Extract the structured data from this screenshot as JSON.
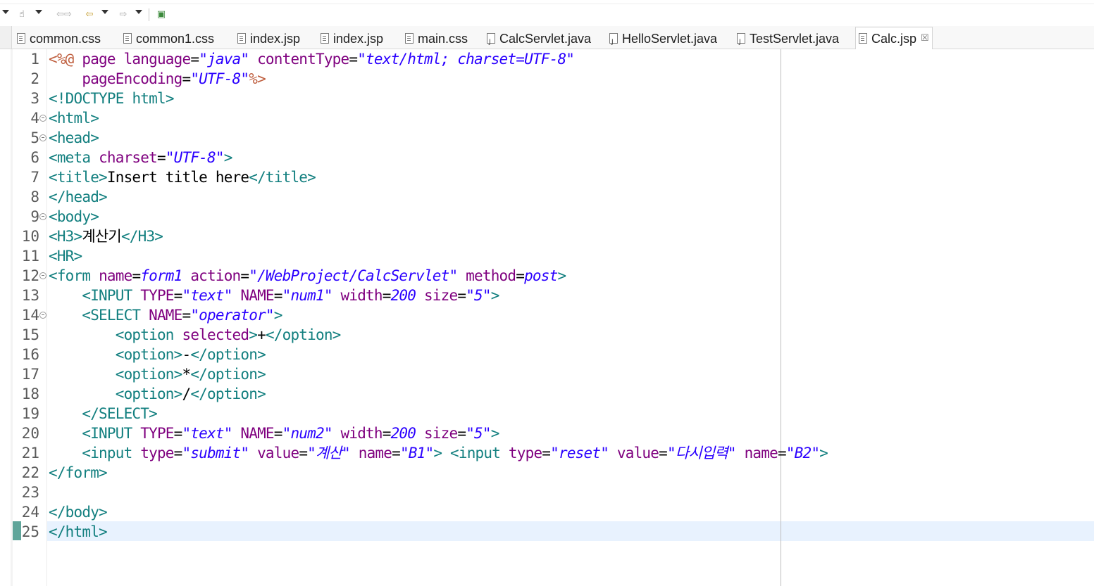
{
  "toolbar": {
    "items": [
      "▾",
      "☝",
      "▾",
      "⇦⇨",
      "⇦",
      "▾",
      "⇨",
      "▾",
      "▣"
    ]
  },
  "tabs": [
    {
      "label": "common.css",
      "type": "css"
    },
    {
      "label": "common1.css",
      "type": "css"
    },
    {
      "label": "index.jsp",
      "type": "jsp"
    },
    {
      "label": "index.jsp",
      "type": "jsp"
    },
    {
      "label": "main.css",
      "type": "css"
    },
    {
      "label": "CalcServlet.java",
      "type": "java"
    },
    {
      "label": "HelloServlet.java",
      "type": "java"
    },
    {
      "label": "TestServlet.java",
      "type": "java"
    },
    {
      "label": "Calc.jsp",
      "type": "jsp",
      "active": true,
      "close": "☒"
    }
  ],
  "editor": {
    "current_line": 25,
    "lines": [
      {
        "n": "1",
        "fold": false,
        "tokens": [
          [
            "jd",
            "<%@"
          ],
          [
            "tx",
            " "
          ],
          [
            "at",
            "page"
          ],
          [
            "tx",
            " "
          ],
          [
            "at",
            "language"
          ],
          [
            "tx",
            "="
          ],
          [
            "av",
            "\"java\""
          ],
          [
            "tx",
            " "
          ],
          [
            "at",
            "contentType"
          ],
          [
            "tx",
            "="
          ],
          [
            "av",
            "\"text/html; charset=UTF-8\""
          ]
        ]
      },
      {
        "n": "2",
        "fold": false,
        "tokens": [
          [
            "tx",
            "    "
          ],
          [
            "at",
            "pageEncoding"
          ],
          [
            "tx",
            "="
          ],
          [
            "av",
            "\"UTF-8\""
          ],
          [
            "jd",
            "%>"
          ]
        ]
      },
      {
        "n": "3",
        "fold": false,
        "tokens": [
          [
            "dt",
            "<!DOCTYPE"
          ],
          [
            "tx",
            " "
          ],
          [
            "dt",
            "html"
          ],
          [
            "dt",
            ">"
          ]
        ]
      },
      {
        "n": "4",
        "fold": true,
        "tokens": [
          [
            "tg",
            "<html>"
          ]
        ]
      },
      {
        "n": "5",
        "fold": true,
        "tokens": [
          [
            "tg",
            "<head>"
          ]
        ]
      },
      {
        "n": "6",
        "fold": false,
        "tokens": [
          [
            "tg",
            "<meta"
          ],
          [
            "tx",
            " "
          ],
          [
            "at",
            "charset"
          ],
          [
            "tx",
            "="
          ],
          [
            "av",
            "\"UTF-8\""
          ],
          [
            "tg",
            ">"
          ]
        ]
      },
      {
        "n": "7",
        "fold": false,
        "tokens": [
          [
            "tg",
            "<title>"
          ],
          [
            "tx",
            "Insert title here"
          ],
          [
            "tg",
            "</title>"
          ]
        ]
      },
      {
        "n": "8",
        "fold": false,
        "tokens": [
          [
            "tg",
            "</head>"
          ]
        ]
      },
      {
        "n": "9",
        "fold": true,
        "tokens": [
          [
            "tg",
            "<body>"
          ]
        ]
      },
      {
        "n": "10",
        "fold": false,
        "tokens": [
          [
            "tg",
            "<H3>"
          ],
          [
            "tx",
            "계산기"
          ],
          [
            "tg",
            "</H3>"
          ]
        ]
      },
      {
        "n": "11",
        "fold": false,
        "tokens": [
          [
            "tg",
            "<HR>"
          ]
        ]
      },
      {
        "n": "12",
        "fold": true,
        "tokens": [
          [
            "tg",
            "<form"
          ],
          [
            "tx",
            " "
          ],
          [
            "at",
            "name"
          ],
          [
            "tx",
            "="
          ],
          [
            "av",
            "form1"
          ],
          [
            "tx",
            " "
          ],
          [
            "at",
            "action"
          ],
          [
            "tx",
            "="
          ],
          [
            "av",
            "\"/WebProject/CalcServlet\""
          ],
          [
            "tx",
            " "
          ],
          [
            "at",
            "method"
          ],
          [
            "tx",
            "="
          ],
          [
            "av",
            "post"
          ],
          [
            "tg",
            ">"
          ]
        ]
      },
      {
        "n": "13",
        "fold": false,
        "tokens": [
          [
            "tx",
            "    "
          ],
          [
            "tg",
            "<INPUT"
          ],
          [
            "tx",
            " "
          ],
          [
            "at",
            "TYPE"
          ],
          [
            "tx",
            "="
          ],
          [
            "av",
            "\"text\""
          ],
          [
            "tx",
            " "
          ],
          [
            "at",
            "NAME"
          ],
          [
            "tx",
            "="
          ],
          [
            "av",
            "\"num1\""
          ],
          [
            "tx",
            " "
          ],
          [
            "at",
            "width"
          ],
          [
            "tx",
            "="
          ],
          [
            "av",
            "200"
          ],
          [
            "tx",
            " "
          ],
          [
            "at",
            "size"
          ],
          [
            "tx",
            "="
          ],
          [
            "av",
            "\"5\""
          ],
          [
            "tg",
            ">"
          ]
        ]
      },
      {
        "n": "14",
        "fold": true,
        "tokens": [
          [
            "tx",
            "    "
          ],
          [
            "tg",
            "<SELECT"
          ],
          [
            "tx",
            " "
          ],
          [
            "at",
            "NAME"
          ],
          [
            "tx",
            "="
          ],
          [
            "av",
            "\"operator\""
          ],
          [
            "tg",
            ">"
          ]
        ]
      },
      {
        "n": "15",
        "fold": false,
        "tokens": [
          [
            "tx",
            "        "
          ],
          [
            "tg",
            "<option"
          ],
          [
            "tx",
            " "
          ],
          [
            "at",
            "selected"
          ],
          [
            "tg",
            ">"
          ],
          [
            "tx",
            "+"
          ],
          [
            "tg",
            "</option>"
          ]
        ]
      },
      {
        "n": "16",
        "fold": false,
        "tokens": [
          [
            "tx",
            "        "
          ],
          [
            "tg",
            "<option>"
          ],
          [
            "tx",
            "-"
          ],
          [
            "tg",
            "</option>"
          ]
        ]
      },
      {
        "n": "17",
        "fold": false,
        "tokens": [
          [
            "tx",
            "        "
          ],
          [
            "tg",
            "<option>"
          ],
          [
            "tx",
            "*"
          ],
          [
            "tg",
            "</option>"
          ]
        ]
      },
      {
        "n": "18",
        "fold": false,
        "tokens": [
          [
            "tx",
            "        "
          ],
          [
            "tg",
            "<option>"
          ],
          [
            "tx",
            "/"
          ],
          [
            "tg",
            "</option>"
          ]
        ]
      },
      {
        "n": "19",
        "fold": false,
        "tokens": [
          [
            "tx",
            "    "
          ],
          [
            "tg",
            "</SELECT>"
          ]
        ]
      },
      {
        "n": "20",
        "fold": false,
        "tokens": [
          [
            "tx",
            "    "
          ],
          [
            "tg",
            "<INPUT"
          ],
          [
            "tx",
            " "
          ],
          [
            "at",
            "TYPE"
          ],
          [
            "tx",
            "="
          ],
          [
            "av",
            "\"text\""
          ],
          [
            "tx",
            " "
          ],
          [
            "at",
            "NAME"
          ],
          [
            "tx",
            "="
          ],
          [
            "av",
            "\"num2\""
          ],
          [
            "tx",
            " "
          ],
          [
            "at",
            "width"
          ],
          [
            "tx",
            "="
          ],
          [
            "av",
            "200"
          ],
          [
            "tx",
            " "
          ],
          [
            "at",
            "size"
          ],
          [
            "tx",
            "="
          ],
          [
            "av",
            "\"5\""
          ],
          [
            "tg",
            ">"
          ]
        ]
      },
      {
        "n": "21",
        "fold": false,
        "tokens": [
          [
            "tx",
            "    "
          ],
          [
            "tg",
            "<input"
          ],
          [
            "tx",
            " "
          ],
          [
            "at",
            "type"
          ],
          [
            "tx",
            "="
          ],
          [
            "av",
            "\"submit\""
          ],
          [
            "tx",
            " "
          ],
          [
            "at",
            "value"
          ],
          [
            "tx",
            "="
          ],
          [
            "av",
            "\"계산\""
          ],
          [
            "tx",
            " "
          ],
          [
            "at",
            "name"
          ],
          [
            "tx",
            "="
          ],
          [
            "av",
            "\"B1\""
          ],
          [
            "tg",
            ">"
          ],
          [
            "tx",
            " "
          ],
          [
            "tg",
            "<input"
          ],
          [
            "tx",
            " "
          ],
          [
            "at",
            "type"
          ],
          [
            "tx",
            "="
          ],
          [
            "av",
            "\"reset\""
          ],
          [
            "tx",
            " "
          ],
          [
            "at",
            "value"
          ],
          [
            "tx",
            "="
          ],
          [
            "av",
            "\"다시입력\""
          ],
          [
            "tx",
            " "
          ],
          [
            "at",
            "name"
          ],
          [
            "tx",
            "="
          ],
          [
            "av",
            "\"B2\""
          ],
          [
            "tg",
            ">"
          ]
        ]
      },
      {
        "n": "22",
        "fold": false,
        "tokens": [
          [
            "tg",
            "</form>"
          ]
        ]
      },
      {
        "n": "23",
        "fold": false,
        "tokens": []
      },
      {
        "n": "24",
        "fold": false,
        "tokens": [
          [
            "tg",
            "</body>"
          ]
        ]
      },
      {
        "n": "25",
        "fold": false,
        "tokens": [
          [
            "tg",
            "</html>"
          ]
        ]
      }
    ]
  }
}
